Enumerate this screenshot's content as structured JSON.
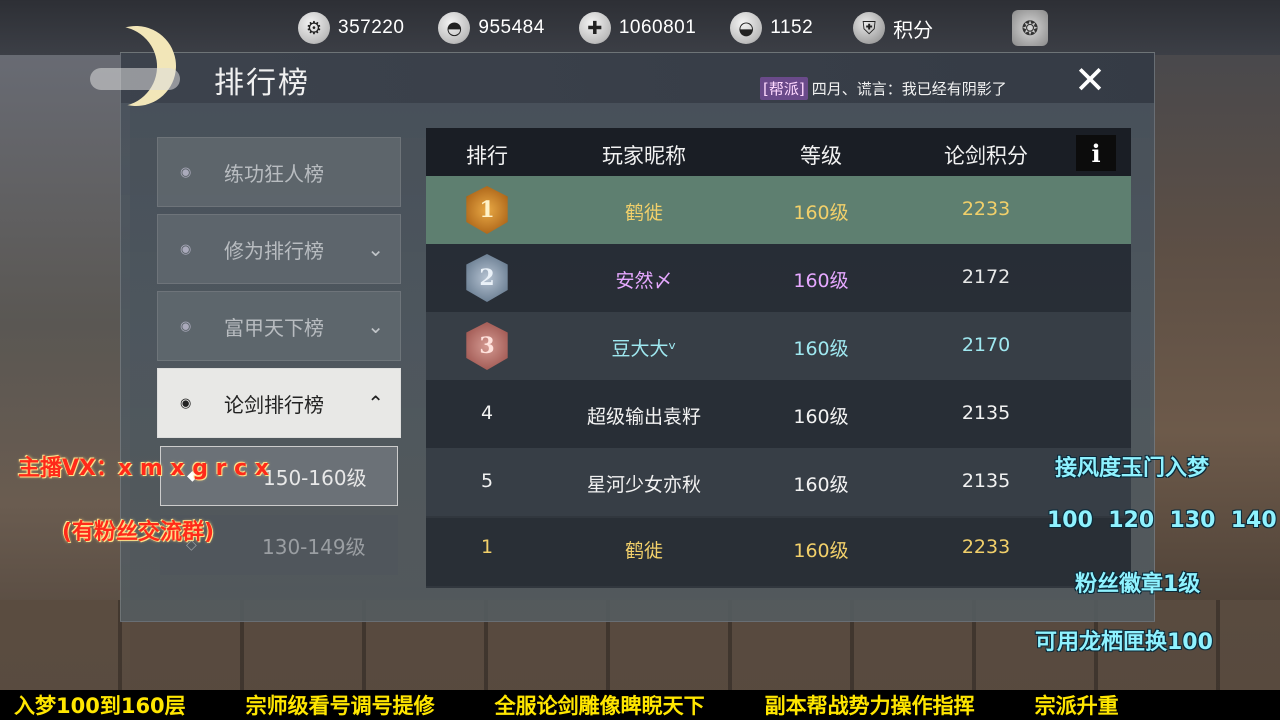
{
  "resources": [
    {
      "icon": "gear-coin-icon",
      "value": "357220"
    },
    {
      "icon": "silver-ingot-icon",
      "value": "955484"
    },
    {
      "icon": "bound-silver-icon",
      "value": "1060801"
    },
    {
      "icon": "gold-ingot-icon",
      "value": "1152"
    }
  ],
  "points": {
    "label": "积分",
    "icon": "shield-points-icon"
  },
  "panel": {
    "title": "排行榜",
    "chat_tag": "[帮派]",
    "chat_text": "四月、谎言：我已经有阴影了",
    "close_symbol": "✕"
  },
  "menu": [
    {
      "label": "练功狂人榜",
      "chevron": "",
      "active": false
    },
    {
      "label": "修为排行榜",
      "chevron": "⌄",
      "active": false
    },
    {
      "label": "富甲天下榜",
      "chevron": "⌄",
      "active": false
    },
    {
      "label": "论剑排行榜",
      "chevron": "⌃",
      "active": true
    }
  ],
  "submenu": [
    {
      "label": "150-160级",
      "selected": true
    },
    {
      "label": "130-149级",
      "selected": false
    }
  ],
  "table": {
    "headers": {
      "rank": "排行",
      "name": "玩家昵称",
      "level": "等级",
      "score": "论剑积分"
    },
    "info_symbol": "i",
    "rows": [
      {
        "rank": "1",
        "medal": "gold",
        "name": "鹤徙",
        "level": "160级",
        "score": "2233",
        "color": "#f2d06a"
      },
      {
        "rank": "2",
        "medal": "silver",
        "name": "安然〆",
        "level": "160级",
        "score": "2172",
        "color": "#e6a8ff"
      },
      {
        "rank": "3",
        "medal": "bronze",
        "name": "豆大大ᵛ",
        "level": "160级",
        "score": "2170",
        "color": "#9fe8f0"
      },
      {
        "rank": "4",
        "medal": "",
        "name": "超级输出袁籽",
        "level": "160级",
        "score": "2135",
        "color": "#f2f2f2"
      },
      {
        "rank": "5",
        "medal": "",
        "name": "星河少女亦秋",
        "level": "160级",
        "score": "2135",
        "color": "#f2f2f2"
      }
    ],
    "my_row": {
      "rank": "1",
      "name": "鹤徙",
      "level": "160级",
      "score": "2233",
      "color": "#f2d06a"
    }
  },
  "overlay": {
    "vx": "主播VX：x m x g r c x",
    "fans_group": "(有粉丝交流群)",
    "right_lines": [
      "接风度玉门入梦",
      "100  120  130  140",
      "粉丝徽章1级",
      "可用龙栖匣换100"
    ],
    "ticker": [
      "入梦100到160层",
      "宗师级看号调号提修",
      "全服论剑雕像睥睨天下",
      "副本帮战势力操作指挥",
      "宗派升重"
    ]
  }
}
